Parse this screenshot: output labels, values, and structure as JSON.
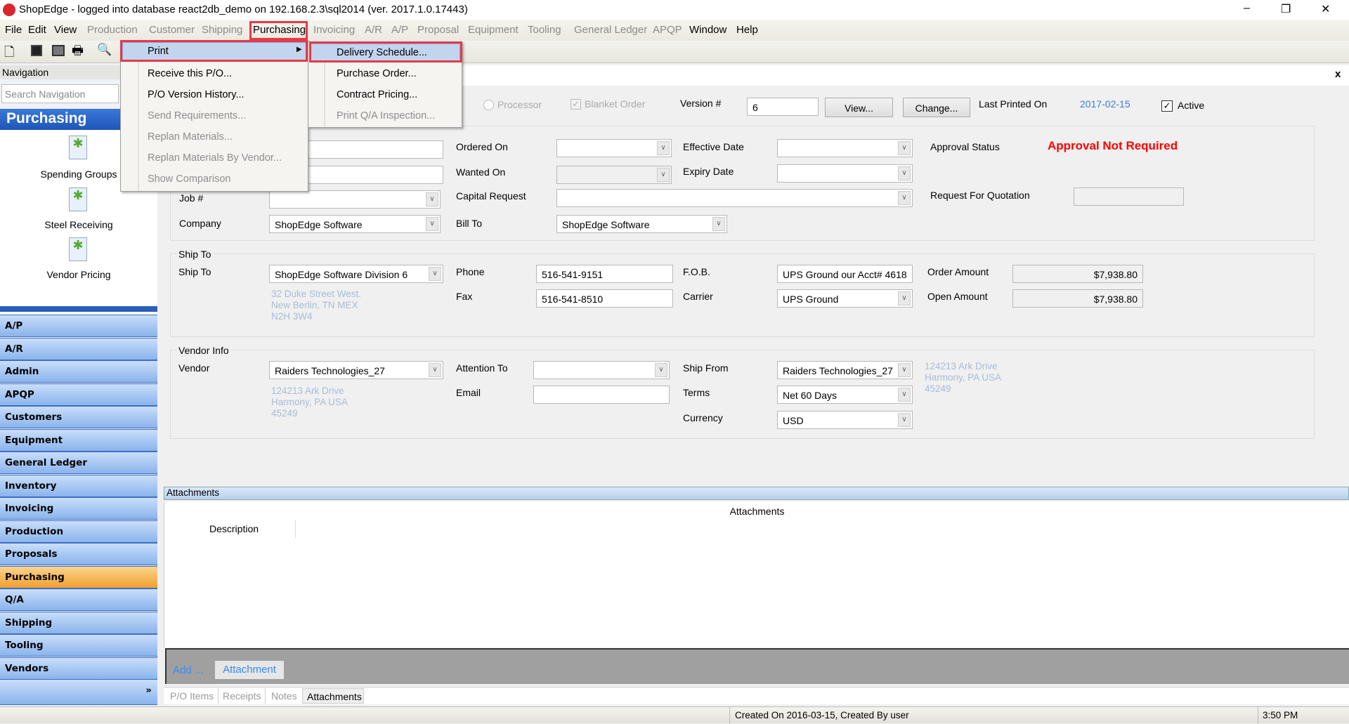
{
  "window": {
    "title": "ShopEdge -  logged into database react2db_demo on 192.168.2.3\\sql2014 (ver. 2017.1.0.17443)",
    "minimize": "–",
    "restore": "❐",
    "close": "✕"
  },
  "menubar": [
    {
      "label": "File",
      "enabled": true
    },
    {
      "label": "Edit",
      "enabled": true
    },
    {
      "label": "View",
      "enabled": true
    },
    {
      "label": "Production",
      "enabled": false
    },
    {
      "label": "Customer",
      "enabled": false
    },
    {
      "label": "Shipping",
      "enabled": false
    },
    {
      "label": "Purchasing",
      "enabled": true
    },
    {
      "label": "Invoicing",
      "enabled": false
    },
    {
      "label": "A/R",
      "enabled": false
    },
    {
      "label": "A/P",
      "enabled": false
    },
    {
      "label": "Proposal",
      "enabled": false
    },
    {
      "label": "Equipment",
      "enabled": false
    },
    {
      "label": "Tooling",
      "enabled": false
    },
    {
      "label": "General Ledger",
      "enabled": false
    },
    {
      "label": "APQP",
      "enabled": false
    },
    {
      "label": "Window",
      "enabled": true
    },
    {
      "label": "Help",
      "enabled": true
    }
  ],
  "purchasing_menu": [
    {
      "label": "Print",
      "enabled": true
    },
    {
      "label": "Receive this P/O...",
      "enabled": true
    },
    {
      "label": "P/O Version History...",
      "enabled": true
    },
    {
      "label": "Send Requirements...",
      "enabled": false
    },
    {
      "label": "Replan Materials...",
      "enabled": false
    },
    {
      "label": "Replan Materials By Vendor...",
      "enabled": false
    },
    {
      "label": "Show Comparison",
      "enabled": false
    }
  ],
  "print_submenu": [
    {
      "label": "Delivery Schedule...",
      "enabled": true
    },
    {
      "label": "Purchase Order...",
      "enabled": true
    },
    {
      "label": "Contract Pricing...",
      "enabled": true
    },
    {
      "label": "Print Q/A Inspection...",
      "enabled": false
    }
  ],
  "sidebar": {
    "header": "Navigation",
    "search_placeholder": "Search Navigation",
    "section_title": "Purchasing",
    "shortcuts": [
      "Spending Groups",
      "Steel Receiving",
      "Vendor Pricing"
    ],
    "modules": [
      "A/P",
      "A/R",
      "Admin",
      "APQP",
      "Customers",
      "Equipment",
      "General Ledger",
      "Inventory",
      "Invoicing",
      "Production",
      "Proposals",
      "Purchasing",
      "Q/A",
      "Shipping",
      "Tooling",
      "Vendors"
    ],
    "selected": "Purchasing",
    "more": "»"
  },
  "form": {
    "processor": "Processor",
    "blanket_order": "Blanket Order",
    "version_label": "Version #",
    "version": "6",
    "view_btn": "View...",
    "change_btn": "Change...",
    "last_printed_label": "Last Printed On",
    "last_printed": "2017-02-15",
    "active_label": "Active",
    "job_label": "Job #",
    "company_label": "Company",
    "company": "ShopEdge Software",
    "ordered_on_label": "Ordered On",
    "wanted_on_label": "Wanted On",
    "capital_request_label": "Capital Request",
    "bill_to_label": "Bill To",
    "bill_to": "ShopEdge Software",
    "effective_date_label": "Effective Date",
    "expiry_date_label": "Expiry Date",
    "approval_status_label": "Approval Status",
    "approval_status": "Approval Not Required",
    "rfq_label": "Request For Quotation",
    "ship_to_group": "Ship To",
    "ship_to_label": "Ship To",
    "ship_to": "ShopEdge Software Division 6",
    "ship_to_address": [
      "32 Duke Street West.",
      "New Berlin, TN MEX",
      "N2H 3W4"
    ],
    "phone_label": "Phone",
    "phone": "516-541-9151",
    "fax_label": "Fax",
    "fax": "516-541-8510",
    "fob_label": "F.O.B.",
    "fob": "UPS Ground our Acct# 4618",
    "carrier_label": "Carrier",
    "carrier": "UPS Ground",
    "order_amount_label": "Order Amount",
    "order_amount": "$7,938.80",
    "open_amount_label": "Open Amount",
    "open_amount": "$7,938.80",
    "vendor_group": "Vendor Info",
    "vendor_label": "Vendor",
    "vendor": "Raiders Technologies_27",
    "vendor_address": [
      "124213 Ark Drive",
      "Harmony, PA USA",
      "45249"
    ],
    "attention_label": "Attention To",
    "email_label": "Email",
    "ship_from_label": "Ship From",
    "ship_from": "Raiders Technologies_27",
    "ship_from_address": [
      "124213 Ark Drive",
      "Harmony, PA USA",
      "45249"
    ],
    "terms_label": "Terms",
    "terms": "Net 60 Days",
    "currency_label": "Currency",
    "currency": "USD"
  },
  "attachments": {
    "bar": "Attachments",
    "title": "Attachments",
    "col": "Description",
    "add": "Add ...",
    "attach_btn": "Attachment"
  },
  "tabs": [
    {
      "label": "P/O Items"
    },
    {
      "label": "Receipts"
    },
    {
      "label": "Notes"
    },
    {
      "label": "Attachments"
    }
  ],
  "active_tab": "Attachments",
  "status": {
    "created": "Created On 2016-03-15, Created By user",
    "time": "3:50 PM"
  },
  "doc_close": "x",
  "colors": {
    "accent_red": "#e53a48",
    "approval": "#ff0000",
    "link_blue": "#3a7de0",
    "nav_blue": "#8ab4ec",
    "nav_selected": "#f0a030"
  }
}
